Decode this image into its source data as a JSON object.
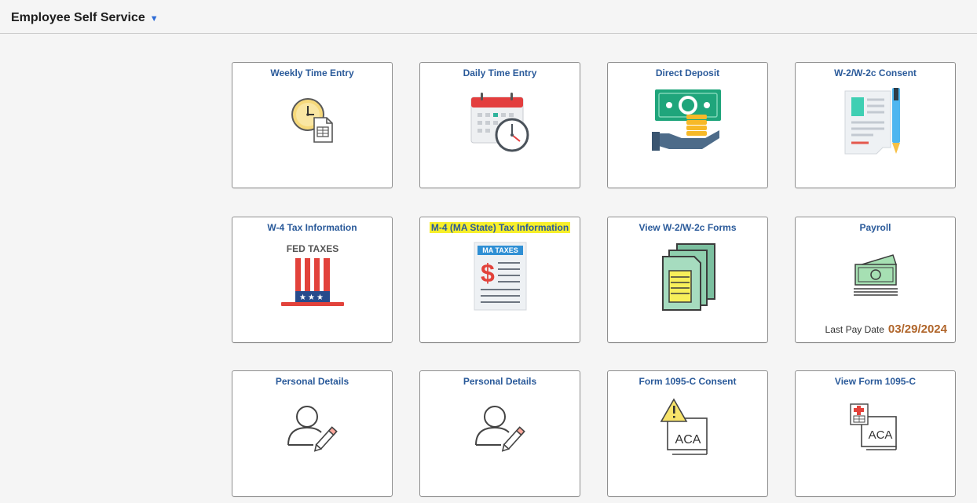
{
  "header": {
    "title": "Employee Self Service",
    "caret_icon": "caret-down-icon"
  },
  "tiles": [
    {
      "title": "Weekly Time Entry",
      "icon": "clock-document-icon"
    },
    {
      "title": "Daily Time Entry",
      "icon": "calendar-clock-icon"
    },
    {
      "title": "Direct Deposit",
      "icon": "money-hand-icon"
    },
    {
      "title": "W-2/W-2c Consent",
      "icon": "document-pen-icon"
    },
    {
      "title": "W-4 Tax Information",
      "icon": "fed-taxes-hat-icon",
      "icon_text": "FED TAXES"
    },
    {
      "title": "M-4 (MA State) Tax Information",
      "icon": "ma-taxes-document-icon",
      "icon_text": "MA TAXES"
    },
    {
      "title": "View W-2/W-2c Forms",
      "icon": "stacked-forms-icon"
    },
    {
      "title": "Payroll",
      "icon": "cash-stack-icon",
      "footer_label": "Last Pay Date",
      "footer_value": "03/29/2024"
    },
    {
      "title": "Personal Details",
      "icon": "person-edit-icon"
    },
    {
      "title": "Personal Details",
      "icon": "person-edit-icon"
    },
    {
      "title": "Form 1095-C Consent",
      "icon": "aca-warning-icon",
      "icon_text": "ACA"
    },
    {
      "title": "View Form 1095-C",
      "icon": "aca-document-icon",
      "icon_text": "ACA"
    }
  ],
  "colors": {
    "link": "#2a5a9a",
    "highlight": "#f7ef2a",
    "pay_date": "#b0652a"
  }
}
